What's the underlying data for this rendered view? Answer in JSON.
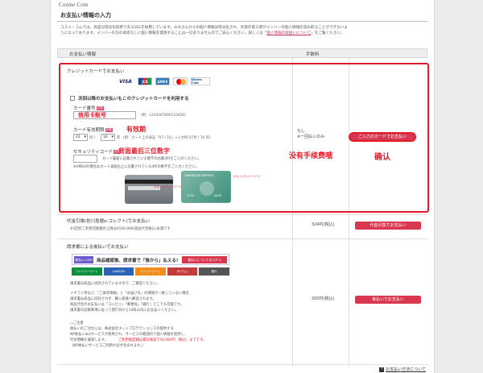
{
  "header": {
    "logo": "Cosme Com",
    "title": "お支払い情報の入力"
  },
  "intro": {
    "line1": "コスメ・コムでは、高度な暗号化技術であるSSLを採用しています。みなさんからの個人情報は暗号化され、外部の第三者がメンバーの個人情報を読み取ることができないよ",
    "line2": "うになっております。メンバーの方の承諾なしに個人情報を漏洩することは一切ありませんのでご安心ください。詳しくは「",
    "link": "個人情報の取扱いについて",
    "line2_end": "」をご覧ください。"
  },
  "table_header": {
    "col1": "お支払い情報",
    "col2": "手数料"
  },
  "credit": {
    "section_title": "クレジットカードでお支払い",
    "cards": [
      "VISA",
      "JCB",
      "AMEX",
      "MC",
      "Diners Club"
    ],
    "remember_label": "次回以降のお支払いもこのクレジットカードを利用する",
    "number_label": "カード番号",
    "required": "必須",
    "number_hint": "(例：1234567890123456)",
    "number_anno": "信用卡账号",
    "expiry_label": "カード有効期限",
    "expiry_hint": "(例：カード上の表記「07 / 16」→入力時 07月 / 16 年)",
    "expiry_anno": "有效期",
    "month": "01",
    "month_unit": "月 /",
    "year": "16",
    "year_unit": "年",
    "security_label": "セキュリティコード",
    "security_anno": "背面最后三位数字",
    "security_note": "カード裏面に記載されている数字の右端3桁をご入力ください。",
    "amex_note": "※AMEXの場合はカード表面右上に記載されている4桁の数字をご入力ください。",
    "seccode_tag": "セキュリティーコード",
    "amex_card_text": "AMERICAN EXPRESS",
    "amex_card_num": "1234",
    "amex_card_code": "5678",
    "fee": "なし",
    "fee_sub": "※一回払いのみ",
    "no_fee_anno": "没有手续费哦",
    "confirm_button": "ご入力のカードでお支払い",
    "confirm_anno": "确认"
  },
  "cod": {
    "section_title": "代金引換(佐川急便e-コレクト)でお支払い",
    "note": "※1回のご利用可能額の上限は¥100,000(商品代金税込)未満です",
    "fee": "324円(税込)",
    "button": "代金引換でお支払い"
  },
  "invoice": {
    "section_title": "請求書による後払いでお支払い",
    "banner_logo": "後払い.com",
    "banner_text": "商品確認後、請求書で「後から」払える!",
    "banner_cta": "後払いについてはコチラ",
    "stores": [
      "ファミリーマート",
      "LAWSON",
      "セイコーマート",
      "ゆうちょ",
      "銀行"
    ],
    "store_colors": [
      "#0a8f3f",
      "#2a64b6",
      "#f28c1b",
      "#c23c3c",
      "#555555"
    ],
    "lines": [
      "請求書は商品に同封されていますので、ご確認ください。",
      "＊ギフト用など、「ご請求情報」と「お届け先」の情報が一致していない場合",
      "請求書は商品に同封されず、購入者様へ郵送されます。",
      "商品代金のお支払いは「コンビニ」「郵便局」「銀行」どこでも可能です。",
      "請求書の記載事項に従って発行日から14日以内にお支払いください。",
      "",
      "○ご注意",
      "後払いのご注文には、株式会社ネットプロテクションズの提供する",
      "NP後払いwizサービスが適用され、サービスの範囲内で個人情報を提供し、",
      "代金債権を譲渡します。",
      "（NP後払いサービスご利用が必ず含まれます。）"
    ],
    "pink_line": "ご利用限度額は累計残高で54,000円（税込）までです。",
    "fee": "200円(税込)",
    "button": "後払いでお支払い"
  },
  "help_link": "お支払い方法について",
  "colors": {
    "accent": "#d9364f",
    "annotation": "#e21c2b"
  }
}
